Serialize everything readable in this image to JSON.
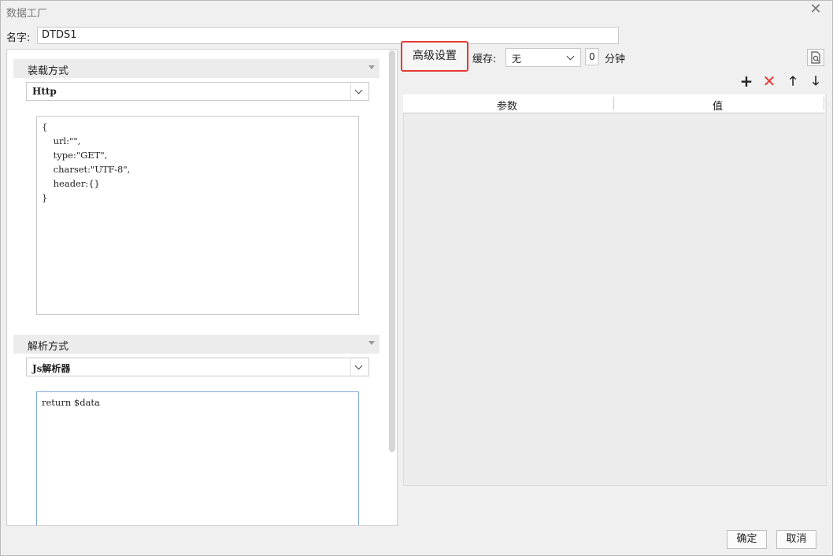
{
  "window": {
    "title": "数据工厂",
    "close_icon": "close-icon"
  },
  "name": {
    "label": "名字:",
    "value": "DTDS1"
  },
  "loader": {
    "section_title": "装载方式",
    "type_value": "Http",
    "code": "{\n    url:\"\",\n    type:\"GET\",\n    charset:\"UTF-8\",\n    header:{}\n}"
  },
  "parser": {
    "section_title": "解析方式",
    "type_value": "Js解析器",
    "code": "return $data"
  },
  "toolbar": {
    "advanced_label": "高级设置",
    "cache_label": "缓存:",
    "cache_value": "无",
    "cache_minutes": "0",
    "minutes_unit": "分钟",
    "add_icon": "+",
    "delete_icon": "✕",
    "up_icon": "🡑",
    "down_icon": "🡓",
    "highlight_color": "#e53935"
  },
  "params_table": {
    "columns": [
      "参数",
      "值"
    ],
    "rows": []
  },
  "footer": {
    "ok_label": "确定",
    "cancel_label": "取消"
  }
}
